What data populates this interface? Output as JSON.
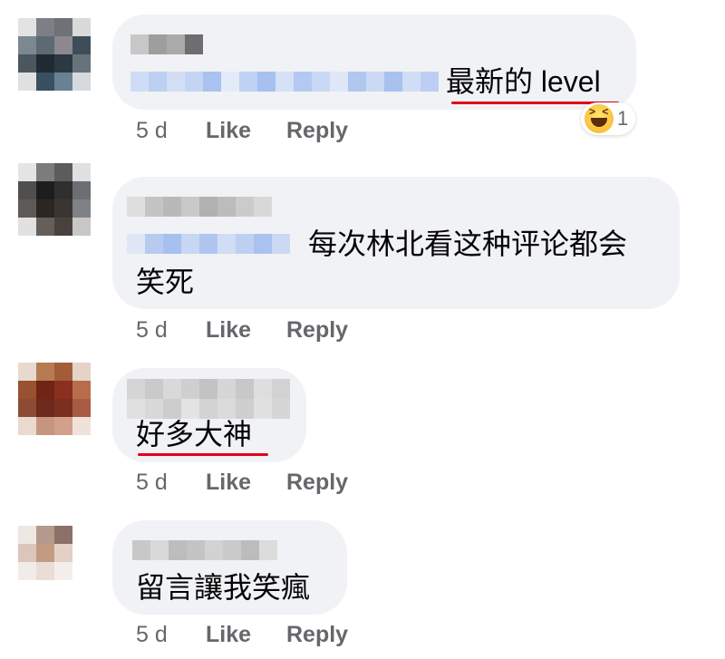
{
  "comments": [
    {
      "text_lines": [
        "最新的 level"
      ],
      "time": "5 d",
      "like_label": "Like",
      "reply_label": "Reply",
      "reaction_count": "1",
      "reaction_icon": "haha-emoji-icon"
    },
    {
      "text_lines": [
        "每次林北看这种评论都会",
        "笑死"
      ],
      "time": "5 d",
      "like_label": "Like",
      "reply_label": "Reply"
    },
    {
      "text_lines": [
        "好多大神"
      ],
      "time": "5 d",
      "like_label": "Like",
      "reply_label": "Reply"
    },
    {
      "text_lines": [
        "留言讓我笑瘋"
      ],
      "time": "5 d",
      "like_label": "Like",
      "reply_label": "Reply"
    }
  ],
  "colors": {
    "bubble": "#f0f2f5",
    "meta_text": "#65676b",
    "underline": "#e0001b",
    "redacted_blue": "#b8cdf0"
  }
}
